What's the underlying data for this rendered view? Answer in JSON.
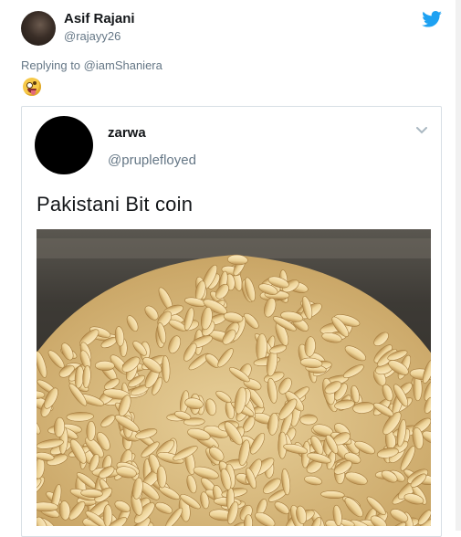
{
  "tweet": {
    "display_name": "Asif Rajani",
    "handle": "@rajayy26",
    "reply_prefix": "Replying to",
    "reply_to": "@iamShaniera",
    "emoji_icon": "zany-face-icon",
    "brand_color": "#1da1f2"
  },
  "quoted": {
    "display_name": "zarwa",
    "handle": "@pruplefloyed",
    "text": "Pakistani Bit coin",
    "image_icon": "pine-nuts-photo"
  }
}
